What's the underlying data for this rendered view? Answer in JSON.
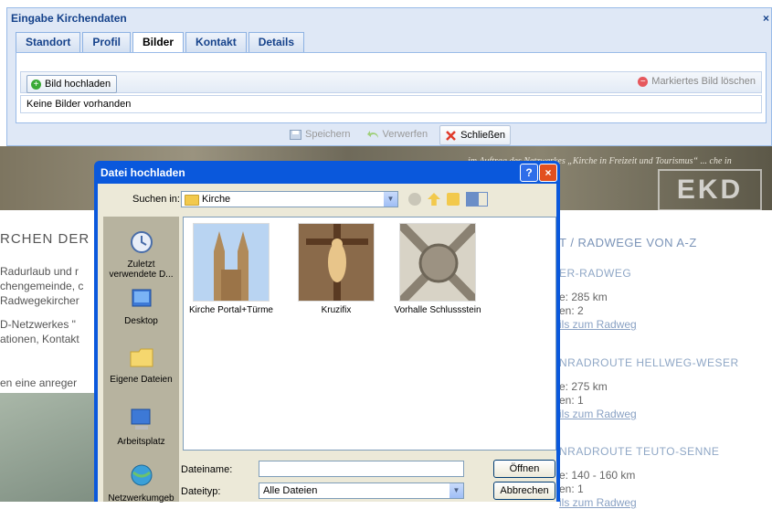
{
  "background": {
    "banner_caption": "im Auftrag des Netzwerkes „Kirche in Freizeit und Tourismus“ ... che in Deutschland (EKD)",
    "banner_logo": "EKD",
    "left_title": "RCHEN DER",
    "left_lines": [
      "Radurlaub und r",
      "chengemeinde, c",
      "Radwegekircher",
      "",
      "D-Netzwerkes \"",
      "ationen, Kontakt",
      "",
      "",
      "en eine anreger"
    ],
    "right_nav": "T / RADWEGE VON A-Z",
    "routes": [
      {
        "title": "ER-RADWEG",
        "line1": "e: 285 km",
        "line2": "en: 2",
        "link": "ils zum Radweg"
      },
      {
        "title": "NRADROUTE HELLWEG-WESER",
        "line1": "e: 275 km",
        "line2": "en: 1",
        "link": "ils zum Radweg"
      },
      {
        "title": "NRADROUTE TEUTO-SENNE",
        "line1": "e: 140 - 160 km",
        "line2": "en: 1",
        "link": "ils zum Radweg"
      }
    ]
  },
  "window": {
    "title": "Eingabe Kirchendaten",
    "close": "×",
    "tabs": [
      "Standort",
      "Profil",
      "Bilder",
      "Kontakt",
      "Details"
    ],
    "active_tab": "Bilder",
    "upload_label": "Bild hochladen",
    "delete_label": "Markiertes Bild löschen",
    "no_images": "Keine Bilder vorhanden",
    "save_label": "Speichern",
    "discard_label": "Verwerfen",
    "close_label": "Schließen"
  },
  "dialog": {
    "title": "Datei hochladen",
    "help": "?",
    "close": "×",
    "lookin_label": "Suchen in:",
    "lookin_value": "Kirche",
    "places": [
      "Zuletzt verwendete D...",
      "Desktop",
      "Eigene Dateien",
      "Arbeitsplatz",
      "Netzwerkumgeb"
    ],
    "files": [
      "Kirche Portal+Türme",
      "Kruzifix",
      "Vorhalle Schlussstein"
    ],
    "filename_label": "Dateiname:",
    "filename_value": "",
    "filetype_label": "Dateityp:",
    "filetype_value": "Alle Dateien",
    "open_label": "Öffnen",
    "cancel_label": "Abbrechen"
  },
  "colors": {
    "accent": "#15428b",
    "dialog_title": "#0a58dc",
    "panel_border": "#99bbe8"
  }
}
